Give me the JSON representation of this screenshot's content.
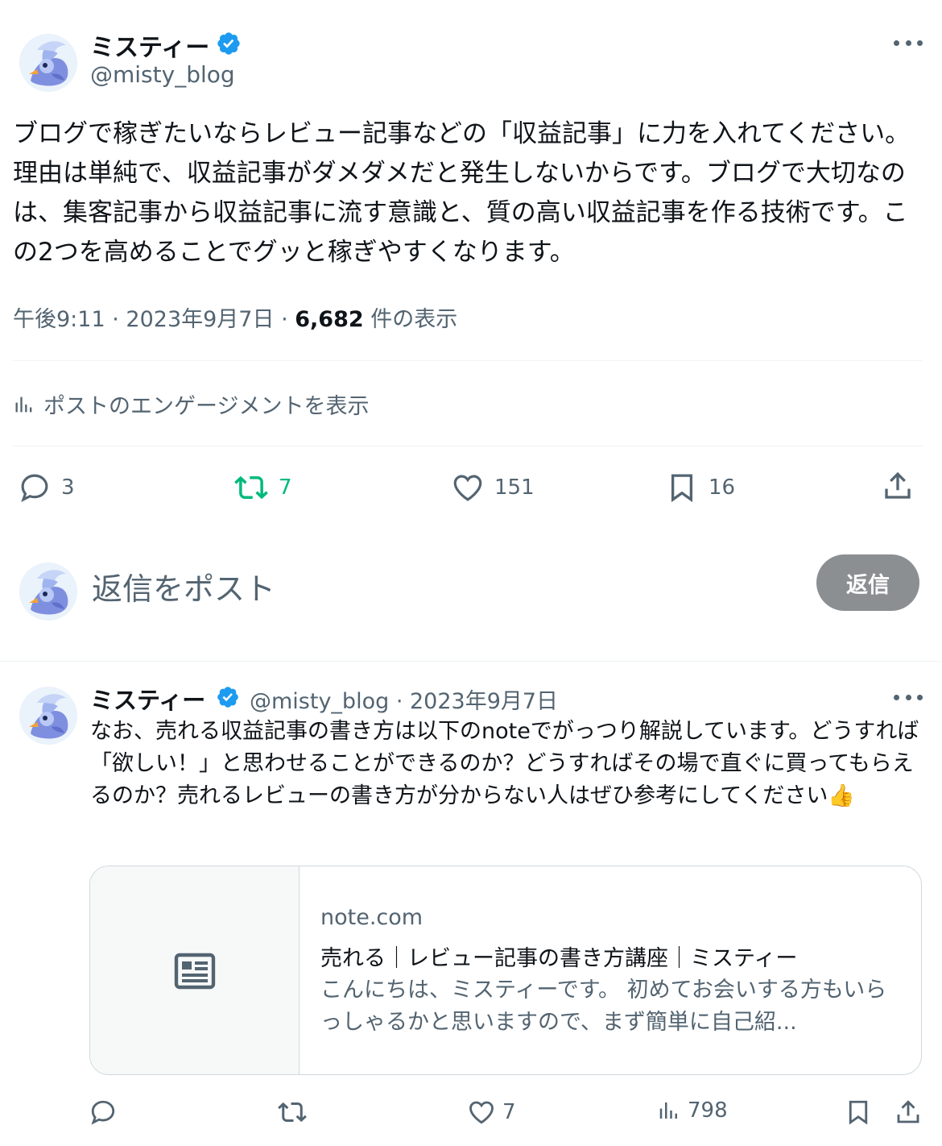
{
  "tweet": {
    "author_name": "ミスティー",
    "handle": "@misty_blog",
    "text": "ブログで稼ぎたいならレビュー記事などの「収益記事」に力を入れてください。理由は単純で、収益記事がダメダメだと発生しないからです。ブログで大切なのは、集客記事から収益記事に流す意識と、質の高い収益記事を作る技術です。この2つを高めることでグッと稼ぎやすくなります。",
    "time": "午後9:11",
    "date": "2023年9月7日",
    "views_count": "6,682",
    "views_label": "件の表示",
    "engagement_link": "ポストのエンゲージメントを表示",
    "replies": "3",
    "reposts": "7",
    "likes": "151",
    "bookmarks": "16"
  },
  "composer": {
    "placeholder": "返信をポスト",
    "button_label": "返信"
  },
  "reply_tweet": {
    "author_name": "ミスティー",
    "handle_date": "@misty_blog · 2023年9月7日",
    "text": "なお、売れる収益記事の書き方は以下のnoteでがっつり解説しています。どうすれば「欲しい！」と思わせることができるのか？どうすればその場で直ぐに買ってもらえるのか？売れるレビューの書き方が分からない人はぜひ参考にしてください👍",
    "card": {
      "domain": "note.com",
      "title": "売れる｜レビュー記事の書き方講座｜ミスティー",
      "description": "こんにちは、ミスティーです。 初めてお会いする方もいらっしゃるかと思いますので、まず簡単に自己紹..."
    },
    "likes": "7",
    "views": "798"
  },
  "colors": {
    "accent": "#1d9bf0",
    "repost_active": "#00ba7c",
    "muted": "#536471",
    "reply_button": "#8b8f92"
  }
}
